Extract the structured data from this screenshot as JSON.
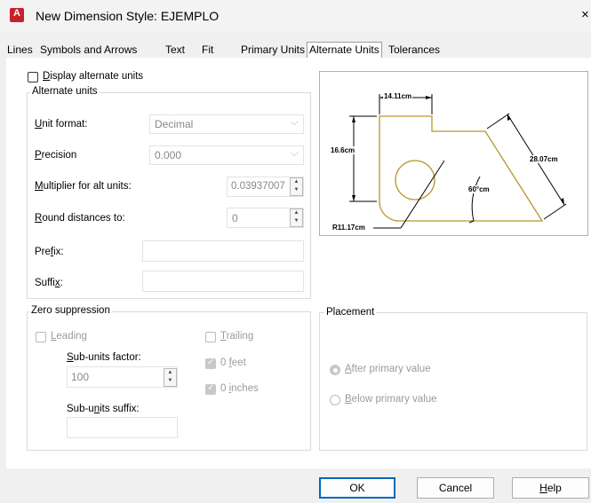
{
  "window": {
    "title": "New Dimension Style: EJEMPLO",
    "close": "×",
    "app_icon": "A"
  },
  "tabs": [
    {
      "label": "Lines"
    },
    {
      "label": "Symbols and Arrows"
    },
    {
      "label": "Text"
    },
    {
      "label": "Fit"
    },
    {
      "label": "Primary Units"
    },
    {
      "label": "Alternate Units",
      "active": true
    },
    {
      "label": "Tolerances"
    }
  ],
  "display_alternate": {
    "mnemonic": "D",
    "rest": "isplay alternate units",
    "checked": false
  },
  "alternate_units": {
    "group_title": "Alternate units",
    "unit_format": {
      "m": "U",
      "rest": "nit format:",
      "value": "Decimal"
    },
    "precision": {
      "m": "P",
      "rest": "recision",
      "value": "0.000"
    },
    "multiplier": {
      "m": "M",
      "rest": "ultiplier for alt units:",
      "value": "0.03937007"
    },
    "round": {
      "m": "R",
      "rest": "ound distances  to:",
      "value": "0"
    },
    "prefix": {
      "a": "Pre",
      "m": "f",
      "b": "ix:",
      "value": ""
    },
    "suffix": {
      "a": "Suffi",
      "m": "x",
      "b": ":",
      "value": ""
    }
  },
  "zero_suppression": {
    "group_title": "Zero suppression",
    "leading": {
      "m": "L",
      "rest": "eading",
      "checked": false
    },
    "trailing": {
      "m": "T",
      "rest": "railing",
      "checked": false
    },
    "subunits_factor": {
      "m": "S",
      "rest": "ub-units factor:",
      "value": "100"
    },
    "feet": {
      "a": "0 ",
      "m": "f",
      "b": "eet",
      "checked": true
    },
    "inches": {
      "a": "0 ",
      "m": "i",
      "b": "nches",
      "checked": true
    },
    "subunits_suffix": {
      "a": "Sub-u",
      "m": "n",
      "b": "its suffix:",
      "value": ""
    }
  },
  "placement": {
    "group_title": "Placement",
    "after": {
      "m": "A",
      "rest": "fter primary value",
      "selected": true
    },
    "below": {
      "m": "B",
      "rest": "elow primary value",
      "selected": false
    }
  },
  "preview": {
    "dim_top": "14.11cm",
    "dim_left": "16.6cm",
    "dim_right": "28.07cm",
    "angle": "60°cm",
    "radius": "R11.17cm"
  },
  "buttons": {
    "ok": "OK",
    "cancel": "Cancel",
    "help_m": "H",
    "help_rest": "elp"
  }
}
